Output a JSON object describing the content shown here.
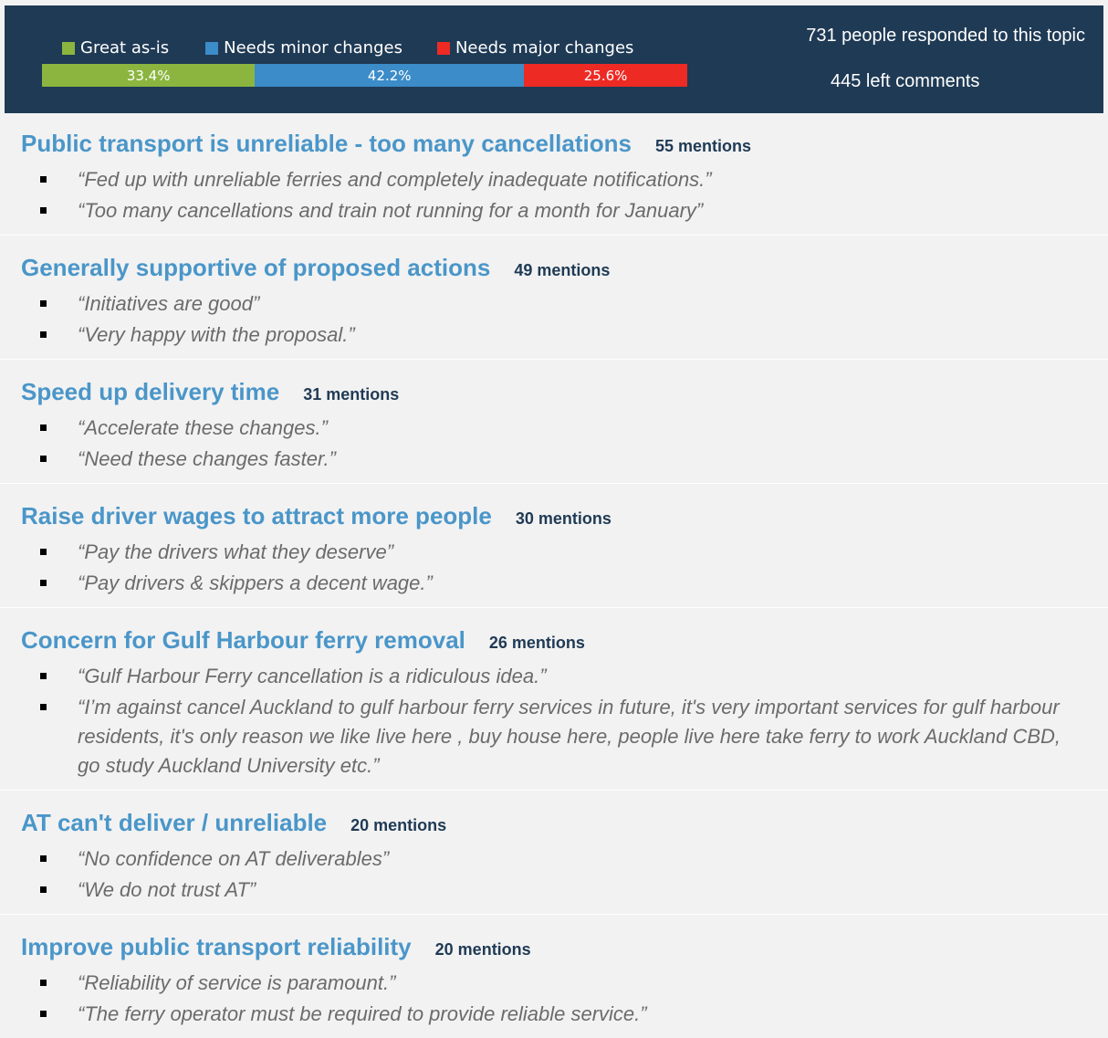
{
  "header": {
    "legend": [
      {
        "label": "Great as-is",
        "color": "#8bb53f"
      },
      {
        "label": "Needs minor changes",
        "color": "#3b8cc8"
      },
      {
        "label": "Needs major changes",
        "color": "#ee2a24"
      }
    ],
    "bar": [
      {
        "label": "33.4%",
        "value": 33.4,
        "color": "#8bb53f"
      },
      {
        "label": "42.2%",
        "value": 42.2,
        "color": "#3b8cc8"
      },
      {
        "label": "25.6%",
        "value": 25.6,
        "color": "#ee2a24"
      }
    ],
    "responded": "731 people responded to this topic",
    "comments": "445 left comments"
  },
  "sections": [
    {
      "title": "Public transport is unreliable - too many cancellations",
      "mentions": "55 mentions",
      "quotes": [
        "“Fed up with unreliable ferries and completely inadequate notifications.”",
        "“Too many cancellations and train not running for a month for January”"
      ]
    },
    {
      "title": "Generally supportive of proposed actions",
      "mentions": "49 mentions",
      "quotes": [
        "“Initiatives are good”",
        "“Very happy with the proposal.”"
      ]
    },
    {
      "title": "Speed up delivery time",
      "mentions": "31 mentions",
      "quotes": [
        "“Accelerate these changes.”",
        "“Need these changes faster.”"
      ]
    },
    {
      "title": "Raise driver wages to attract more people",
      "mentions": "30 mentions",
      "quotes": [
        "“Pay the drivers what they deserve”",
        "“Pay drivers & skippers a decent wage.”"
      ]
    },
    {
      "title": "Concern for Gulf Harbour ferry removal",
      "mentions": "26 mentions",
      "quotes": [
        "“Gulf Harbour Ferry cancellation is a ridiculous idea.”",
        "“I’m against cancel Auckland to gulf harbour ferry services in future, it's very important services for gulf harbour residents, it's only reason we like live here , buy house here, people live here take ferry to work Auckland CBD, go study Auckland University etc.”"
      ]
    },
    {
      "title": "AT can't deliver / unreliable",
      "mentions": "20 mentions",
      "quotes": [
        "“No confidence on AT deliverables”",
        "“We do not trust AT”"
      ]
    },
    {
      "title": "Improve public transport reliability",
      "mentions": "20 mentions",
      "quotes": [
        "“Reliability of service is paramount.”",
        "“The ferry operator must be required to provide reliable service.”"
      ]
    }
  ]
}
